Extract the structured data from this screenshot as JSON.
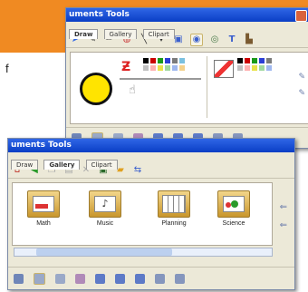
{
  "page": {
    "visible_letter": "f"
  },
  "window_top": {
    "title": "uments Tools",
    "tabs": [
      {
        "label": "Draw"
      },
      {
        "label": "Gallery"
      },
      {
        "label": "Clipart"
      }
    ],
    "active_tab": 0
  },
  "window_bottom": {
    "title": "uments Tools",
    "tabs": [
      {
        "label": "Draw"
      },
      {
        "label": "Gallery"
      },
      {
        "label": "Clipart"
      }
    ],
    "active_tab": 1,
    "apps": [
      {
        "label": "Math"
      },
      {
        "label": "Music"
      },
      {
        "label": "Planning"
      },
      {
        "label": "Science"
      }
    ]
  },
  "colors": {
    "banner": "#f08a22",
    "titlebar": "#0a3ec5",
    "window_bg": "#ece9d8",
    "fill_circle": "#ffe400"
  }
}
